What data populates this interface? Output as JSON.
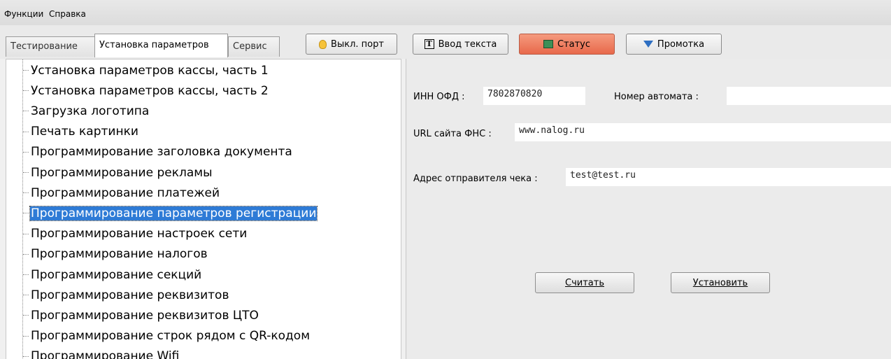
{
  "menu": {
    "functions": "Функции",
    "help": "Справка"
  },
  "tabs": {
    "testing": "Тестирование",
    "settings": "Установка параметров",
    "service": "Сервис"
  },
  "toolbar": {
    "port": "Выкл. порт",
    "text_input": "Ввод текста",
    "status": "Статус",
    "scroll": "Промотка",
    "status_color": "#e8694b"
  },
  "tree": {
    "items": [
      "Установка параметров кассы, часть 1",
      "Установка параметров кассы, часть 2",
      "Загрузка логотипа",
      "Печать картинки",
      "Программирование заголовка документа",
      "Программирование рекламы",
      "Программирование платежей",
      "Программирование параметров регистрации",
      "Программирование настроек сети",
      "Программирование налогов",
      "Программирование секций",
      "Программирование реквизитов",
      "Программирование реквизитов ЦТО",
      "Программирование строк рядом с QR-кодом",
      "Программирование Wifi"
    ],
    "selected_index": 7,
    "selected_color": "#2e7bd6"
  },
  "form": {
    "inn_label": "ИНН ОФД :",
    "inn_value": "7802870820",
    "machine_label": "Номер автомата :",
    "machine_value": "",
    "url_label": "URL сайта ФНС :",
    "url_value": "www.nalog.ru",
    "sender_label": "Адрес отправителя чека :",
    "sender_value": "test@test.ru",
    "read_button": "Считать",
    "set_button": "Установить"
  }
}
